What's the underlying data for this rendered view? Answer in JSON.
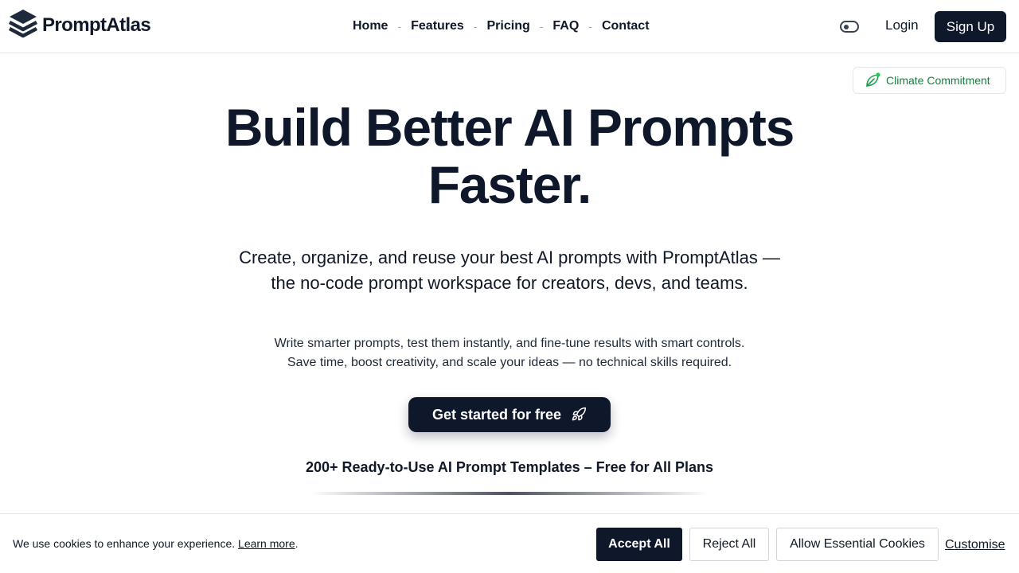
{
  "brand": {
    "name": "PromptAtlas"
  },
  "nav": {
    "items": [
      {
        "label": "Home"
      },
      {
        "label": "Features"
      },
      {
        "label": "Pricing"
      },
      {
        "label": "FAQ"
      },
      {
        "label": "Contact"
      }
    ],
    "separator": "-"
  },
  "header": {
    "login_label": "Login",
    "signup_label": "Sign Up",
    "theme_toggle_icon": "toggle-icon"
  },
  "badge": {
    "label": "Climate Commitment",
    "icon": "leaf-icon",
    "color": "#15803d"
  },
  "hero": {
    "title_line1": "Build Better AI Prompts",
    "title_line2": "Faster.",
    "subtitle": "Create, organize, and reuse your best AI prompts with PromptAtlas — the no-code prompt workspace for creators, devs, and teams.",
    "desc_line1": "Write smarter prompts, test them instantly, and fine-tune results with smart controls.",
    "desc_line2": "Save time, boost creativity, and scale your ideas — no technical skills required.",
    "cta_label": "Get started for free",
    "cta_icon": "rocket-icon",
    "templates_text": "200+ Ready-to-Use AI Prompt Templates – Free for All Plans"
  },
  "cookie": {
    "message": "We use cookies to enhance your experience.",
    "learn_more": "Learn more",
    "period": ".",
    "accept_label": "Accept All",
    "reject_label": "Reject All",
    "essential_label": "Allow Essential Cookies",
    "customise_label": "Customise"
  },
  "colors": {
    "primary": "#0f172a",
    "accent_green": "#15803d",
    "border": "#e5e7eb"
  }
}
